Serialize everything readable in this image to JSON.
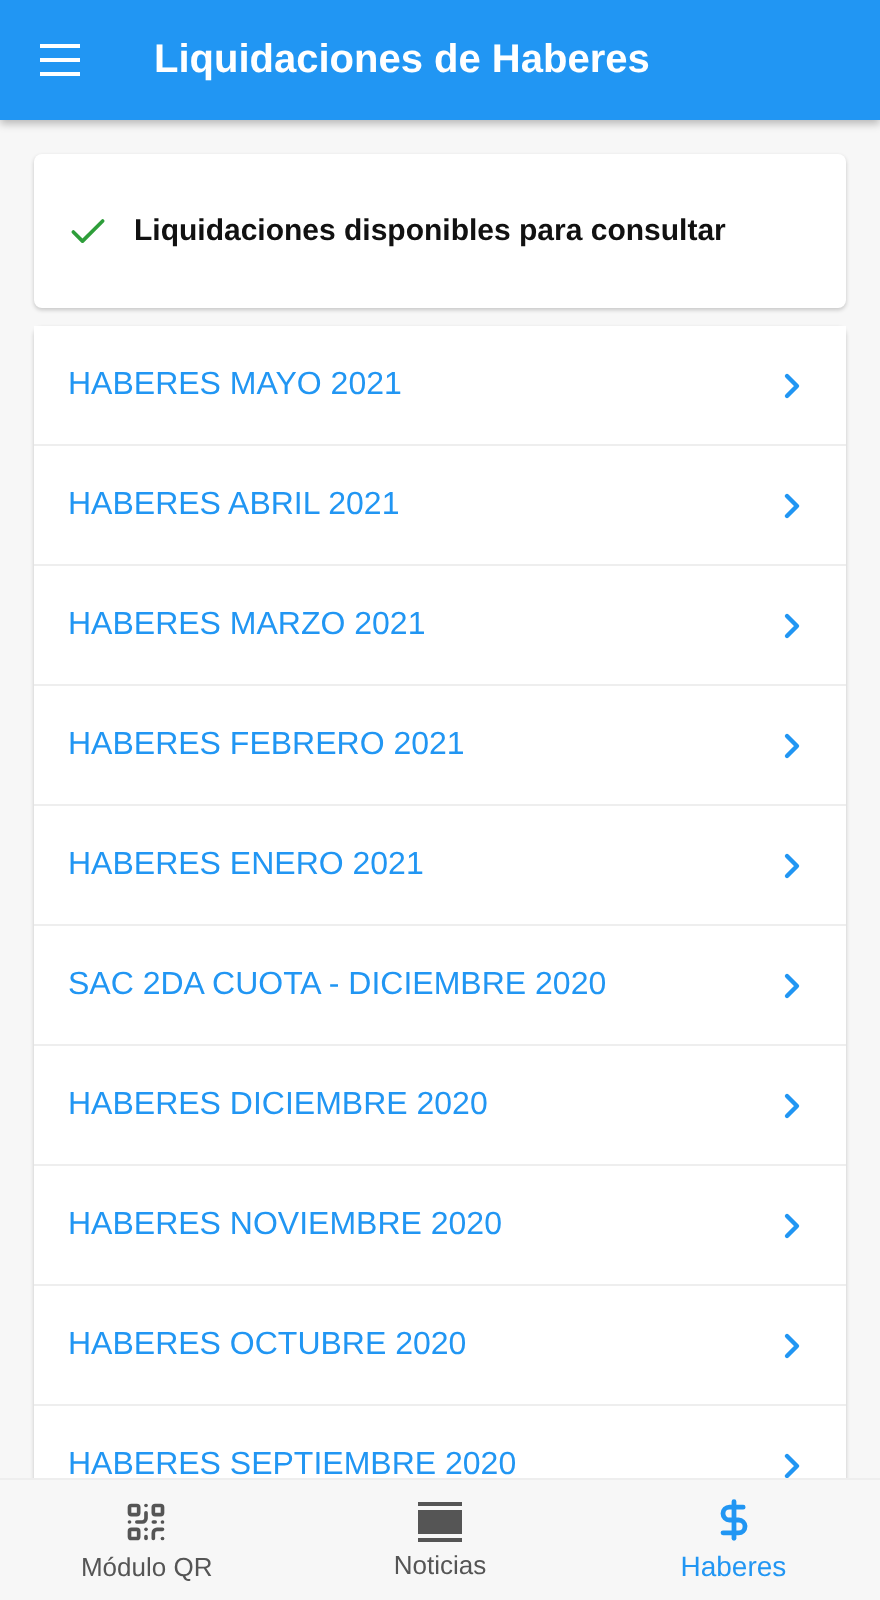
{
  "app_bar": {
    "title": "Liquidaciones de Haberes"
  },
  "notice": {
    "text": "Liquidaciones disponibles para consultar"
  },
  "items": [
    {
      "label": "HABERES MAYO 2021"
    },
    {
      "label": "HABERES ABRIL 2021"
    },
    {
      "label": "HABERES MARZO 2021"
    },
    {
      "label": "HABERES FEBRERO 2021"
    },
    {
      "label": "HABERES ENERO 2021"
    },
    {
      "label": "SAC 2DA CUOTA - DICIEMBRE 2020"
    },
    {
      "label": "HABERES DICIEMBRE 2020"
    },
    {
      "label": "HABERES NOVIEMBRE 2020"
    },
    {
      "label": "HABERES OCTUBRE 2020"
    },
    {
      "label": "HABERES SEPTIEMBRE 2020"
    }
  ],
  "bottom_nav": [
    {
      "kind": "qr",
      "label": "Módulo QR",
      "selected": false
    },
    {
      "kind": "news",
      "label": "Noticias",
      "selected": false
    },
    {
      "kind": "money",
      "label": "Haberes",
      "selected": true
    }
  ]
}
